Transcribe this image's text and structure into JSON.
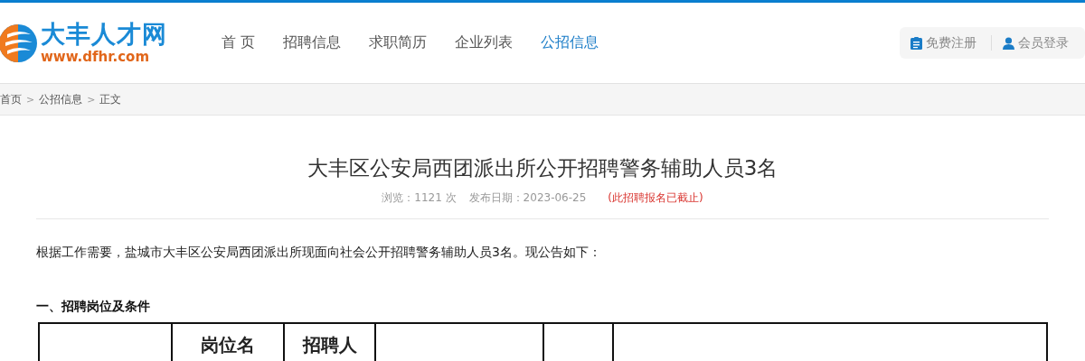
{
  "logo": {
    "name": "大丰人才网",
    "url": "www.dfhr.com"
  },
  "nav": [
    {
      "label": "首 页",
      "selected": false
    },
    {
      "label": "招聘信息",
      "selected": false
    },
    {
      "label": "求职简历",
      "selected": false
    },
    {
      "label": "企业列表",
      "selected": false
    },
    {
      "label": "公招信息",
      "selected": true
    }
  ],
  "user_links": [
    {
      "kind": "register",
      "label": "免费注册"
    },
    {
      "kind": "login",
      "label": "会员登录"
    }
  ],
  "breadcrumb": {
    "separator": ">",
    "items": [
      "首页",
      "公招信息",
      "正文"
    ]
  },
  "article": {
    "title": "大丰区公安局西团派出所公开招聘警务辅助人员3名",
    "views": "浏览：1121 次",
    "date": "发布日期：2023-06-25",
    "status": "(此招聘报名已截止)",
    "intro": "根据工作需要，盐城市大丰区公安局西团派出所现面向社会公开招聘警务辅助人员3名。现公告如下：",
    "section": "一、招聘岗位及条件",
    "table": {
      "columns": [
        {
          "kind": "cut"
        },
        {
          "kind": "text",
          "label": "岗位名"
        },
        {
          "kind": "text",
          "label": "招聘人"
        },
        {
          "kind": "cut"
        },
        {
          "kind": "cut"
        },
        {
          "kind": "cut"
        }
      ]
    }
  }
}
